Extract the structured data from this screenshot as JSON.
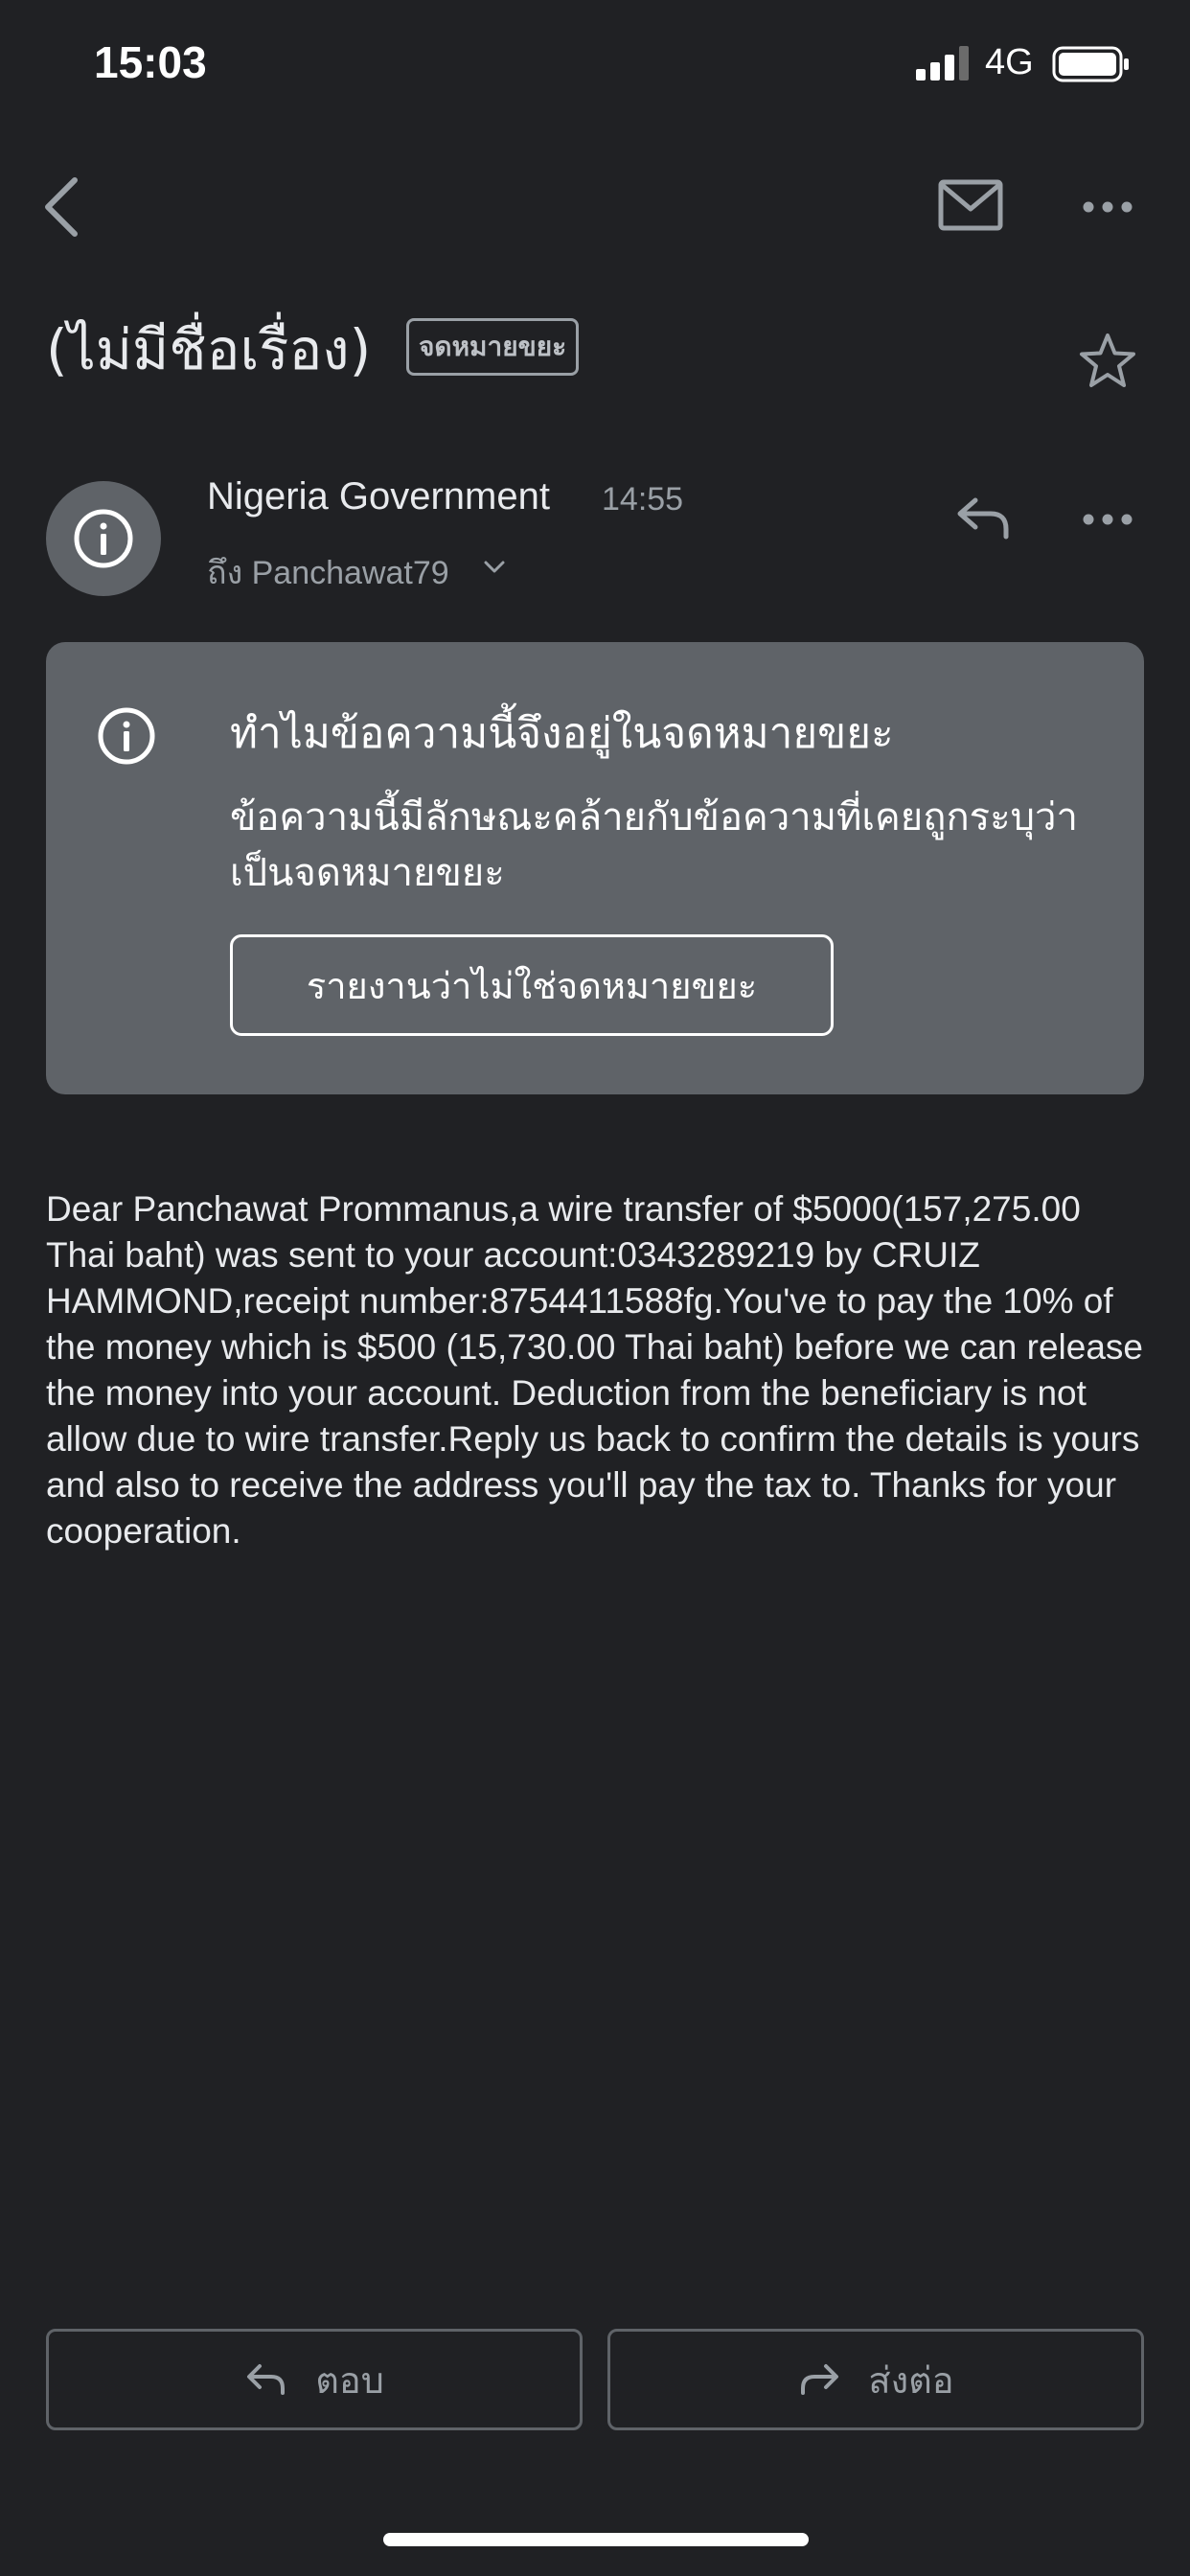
{
  "status_bar": {
    "time": "15:03",
    "network": "4G"
  },
  "header": {
    "subject": "(ไม่มีชื่อเรื่อง)",
    "label_badge": "จดหมายขยะ"
  },
  "sender": {
    "name": "Nigeria Government",
    "time": "14:55",
    "recipient": "ถึง Panchawat79"
  },
  "spam_notice": {
    "title": "ทำไมข้อความนี้จึงอยู่ในจดหมายขยะ",
    "description": "ข้อความนี้มีลักษณะคล้ายกับข้อความที่เคยถูกระบุว่าเป็นจดหมายขยะ",
    "button_label": "รายงานว่าไม่ใช่จดหมายขยะ"
  },
  "message": {
    "body": "Dear Panchawat Prommanus,a wire transfer of $5000(157,275.00 Thai baht) was sent to your account:0343289219 by CRUIZ HAMMOND,receipt number:8754411588fg.You've to pay the 10% of the money which is $500 (15,730.00 Thai baht) before we can release the money into your account. Deduction from the beneficiary is not allow due to wire transfer.Reply us back to confirm the details is yours and also to receive the address you'll pay the tax to. Thanks for your cooperation."
  },
  "actions": {
    "reply_label": "ตอบ",
    "forward_label": "ส่งต่อ"
  },
  "colors": {
    "background": "#202124",
    "card": "#5f6368",
    "text_primary": "#e8eaed",
    "text_secondary": "#9aa0a6"
  }
}
